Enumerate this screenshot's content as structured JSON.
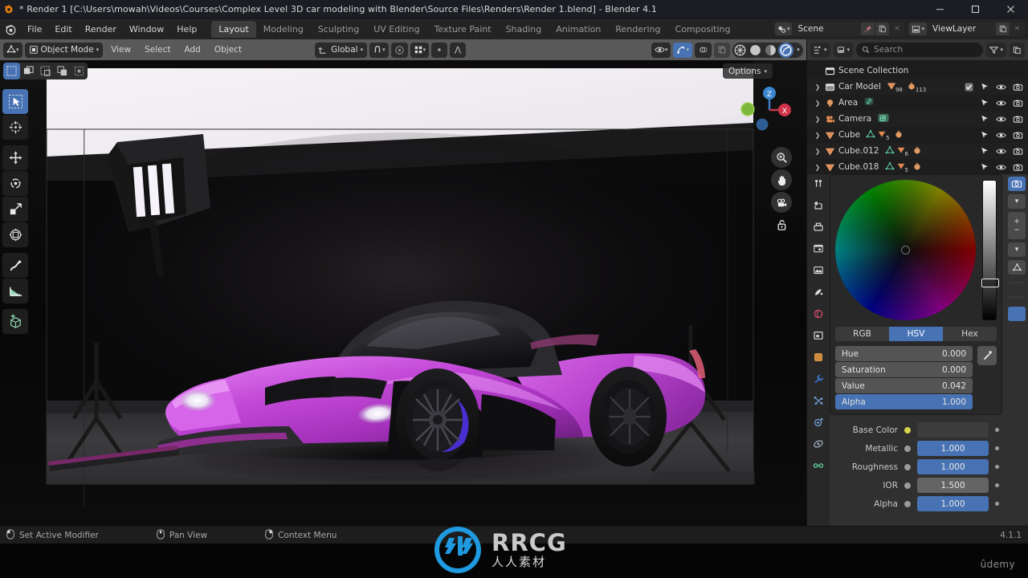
{
  "window": {
    "title": "* Render 1 [C:\\Users\\mowah\\Videos\\Courses\\Complex Level 3D car modeling with Blender\\Source Files\\Renders\\Render 1.blend] - Blender 4.1",
    "app_icon": "blender-icon",
    "minimize": "─",
    "maximize": "⬜",
    "close": "✕"
  },
  "topbar": {
    "menus": [
      "File",
      "Edit",
      "Render",
      "Window",
      "Help"
    ],
    "workspaces": [
      "Layout",
      "Modeling",
      "Sculpting",
      "UV Editing",
      "Texture Paint",
      "Shading",
      "Animation",
      "Rendering",
      "Compositing"
    ],
    "active_workspace": "Layout",
    "scene": {
      "label": "Scene",
      "icon": "scene-icon",
      "pin": "pin-icon",
      "new": "copy-icon",
      "unlink": "✕"
    },
    "viewlayer": {
      "label": "ViewLayer",
      "icon": "viewlayer-icon",
      "new": "copy-icon",
      "unlink": "✕"
    }
  },
  "viewport_header": {
    "editor_type": "editor-type-icon",
    "mode": "Object Mode",
    "menus": [
      "View",
      "Select",
      "Add",
      "Object"
    ],
    "transform_orientation": "Global",
    "snap": "magnet-icon",
    "proportional": "proportional-edit-icon",
    "options": "Options"
  },
  "viewport": {
    "select_modes": [
      "tweak",
      "box-select",
      "circle-select",
      "lasso-select",
      "select-all"
    ],
    "active_select_mode": "tweak",
    "tools": [
      "select-box-tool",
      "cursor-tool",
      "move-tool",
      "rotate-tool",
      "scale-tool",
      "transform-tool",
      "annotate-tool",
      "measure-tool",
      "add-cube-tool"
    ],
    "active_tool": "select-box-tool",
    "gizmo_axes": [
      "X",
      "Y",
      "Z"
    ],
    "nav_buttons": [
      "zoom-icon",
      "pan-icon",
      "camera-icon",
      "lock-icon"
    ]
  },
  "outliner": {
    "display_mode": "View Layer",
    "search_placeholder": "Search",
    "root": "Scene Collection",
    "rows": [
      {
        "name": "Car Model",
        "icon": "collection-icon",
        "indent": 1,
        "badges": [
          {
            "icon": "mesh-data-icon",
            "count": "98"
          },
          {
            "icon": "material-icon",
            "count": "113"
          }
        ],
        "checkbox": true,
        "selectable": true,
        "visible": true,
        "renderable": true
      },
      {
        "name": "Area",
        "icon": "light-icon",
        "indent": 1,
        "badges": [
          {
            "icon": "light-data-icon",
            "count": ""
          }
        ],
        "checkbox": false,
        "selectable": true,
        "visible": true,
        "renderable": true
      },
      {
        "name": "Camera",
        "icon": "camera-obj-icon",
        "indent": 1,
        "badges": [
          {
            "icon": "camera-data-icon",
            "count": ""
          }
        ],
        "checkbox": false,
        "selectable": true,
        "visible": true,
        "renderable": true
      },
      {
        "name": "Cube",
        "icon": "mesh-obj-icon",
        "indent": 1,
        "badges": [
          {
            "icon": "mesh-data-icon",
            "count": ""
          },
          {
            "icon": "modifier-icon",
            "count": "5"
          },
          {
            "icon": "material-icon",
            "count": ""
          }
        ],
        "checkbox": false,
        "selectable": true,
        "visible": true,
        "renderable": true
      },
      {
        "name": "Cube.012",
        "icon": "mesh-obj-icon",
        "indent": 1,
        "badges": [
          {
            "icon": "mesh-data-icon",
            "count": ""
          },
          {
            "icon": "modifier-icon",
            "count": "6"
          },
          {
            "icon": "material-icon",
            "count": ""
          }
        ],
        "checkbox": false,
        "selectable": true,
        "visible": true,
        "renderable": true
      },
      {
        "name": "Cube.018",
        "icon": "mesh-obj-icon",
        "indent": 1,
        "badges": [
          {
            "icon": "mesh-data-icon",
            "count": ""
          },
          {
            "icon": "modifier-icon",
            "count": "5"
          },
          {
            "icon": "material-icon",
            "count": ""
          }
        ],
        "checkbox": false,
        "selectable": true,
        "visible": true,
        "renderable": true
      }
    ]
  },
  "properties": {
    "tabs": [
      "tool-icon",
      "render-icon",
      "output-icon",
      "viewlayer-props-icon",
      "scene-props-icon",
      "world-icon",
      "collection-props-icon",
      "object-icon",
      "modifier-icon",
      "particles-icon",
      "physics-icon",
      "constraints-icon",
      "data-icon",
      "material-props-icon"
    ],
    "active_tab": "material-props-icon",
    "color_picker": {
      "modes": [
        "RGB",
        "HSV",
        "Hex"
      ],
      "active_mode": "HSV",
      "channels": [
        {
          "label": "Hue",
          "value": "0.000",
          "highlight": false
        },
        {
          "label": "Saturation",
          "value": "0.000",
          "highlight": false
        },
        {
          "label": "Value",
          "value": "0.042",
          "highlight": false
        },
        {
          "label": "Alpha",
          "value": "1.000",
          "highlight": true
        }
      ],
      "eyedropper": "eyedropper-icon"
    },
    "material_inputs": [
      {
        "label": "Base Color",
        "value": "",
        "style": "empty",
        "socket": "yellow"
      },
      {
        "label": "Metallic",
        "value": "1.000",
        "style": "blue",
        "socket": "grey"
      },
      {
        "label": "Roughness",
        "value": "1.000",
        "style": "blue",
        "socket": "grey"
      },
      {
        "label": "IOR",
        "value": "1.500",
        "style": "grey",
        "socket": "grey"
      },
      {
        "label": "Alpha",
        "value": "1.000",
        "style": "blue",
        "socket": "grey"
      }
    ]
  },
  "statusbar": {
    "hints": [
      {
        "icon": "mouse-left-icon",
        "label": "Set Active Modifier"
      },
      {
        "icon": "mouse-middle-icon",
        "label": "Pan View"
      },
      {
        "icon": "mouse-right-icon",
        "label": "Context Menu"
      }
    ],
    "version": "4.1.1"
  },
  "watermarks": {
    "rrcg_logo": "rrcg-logo-icon",
    "rrcg_top": "RRCG",
    "rrcg_bottom": "人人素材",
    "udemy": "ûdemy"
  },
  "colors": {
    "accent_blue": "#4772b3",
    "header_grey": "#595959",
    "panel_dark": "#303030",
    "outliner_bg": "#1d1d1d",
    "car_paint": "#c04ad6"
  }
}
